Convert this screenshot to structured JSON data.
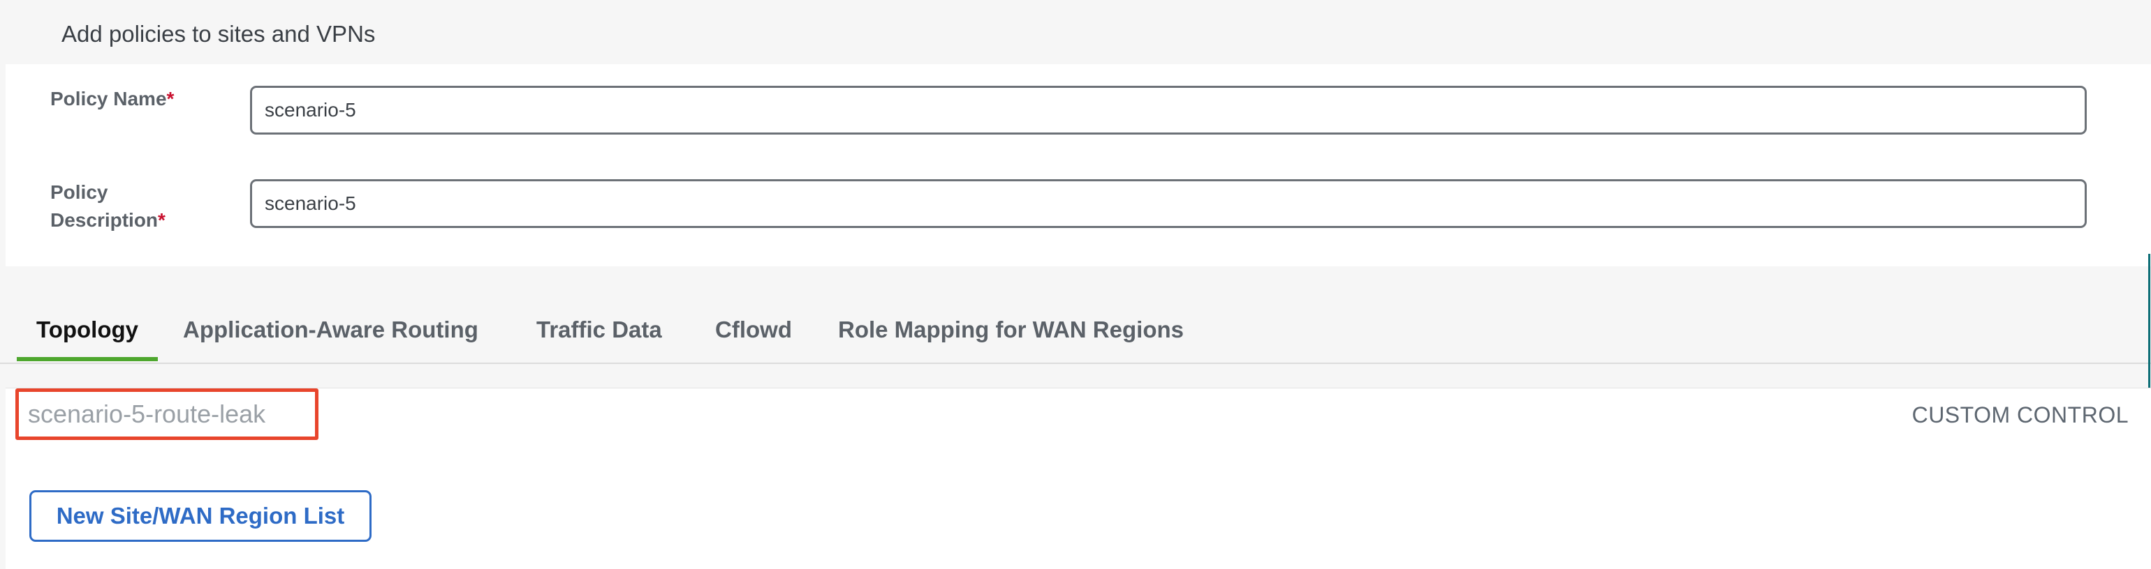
{
  "header": {
    "title": "Add policies to sites and VPNs"
  },
  "form": {
    "policy_name": {
      "label": "Policy Name",
      "required_mark": "*",
      "value": "scenario-5"
    },
    "policy_description": {
      "label_line1": "Policy",
      "label_line2": "Description",
      "required_mark": "*",
      "value": "scenario-5"
    }
  },
  "tabs": [
    {
      "label": "Topology",
      "active": true
    },
    {
      "label": "Application-Aware Routing",
      "active": false
    },
    {
      "label": "Traffic Data",
      "active": false
    },
    {
      "label": "Cflowd",
      "active": false
    },
    {
      "label": "Role Mapping for WAN Regions",
      "active": false
    }
  ],
  "topology": {
    "policy_item_name": "scenario-5-route-leak",
    "policy_item_type": "CUSTOM CONTROL",
    "new_list_button": "New Site/WAN Region List"
  },
  "colors": {
    "accent_blue": "#2e6bc6",
    "active_tab_underline": "#4ea72e",
    "highlight_red": "#e8452c",
    "required_red": "#c8102e"
  }
}
